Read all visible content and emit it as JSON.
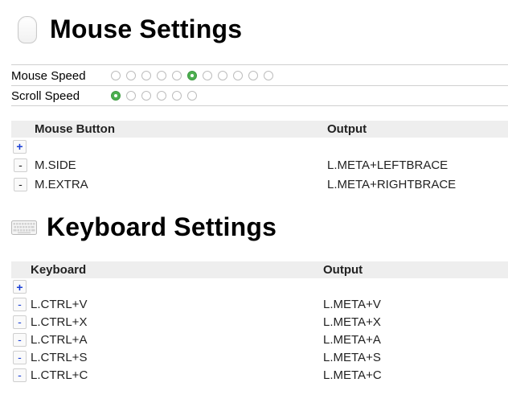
{
  "mouse_section": {
    "title": "Mouse Settings",
    "icon": "mouse-icon",
    "speed": {
      "label": "Mouse Speed",
      "count": 11,
      "selected_index": 5
    },
    "scroll": {
      "label": "Scroll Speed",
      "count": 6,
      "selected_index": 0
    },
    "accent_color": "#4caf50"
  },
  "mouse_table": {
    "headers": [
      "Mouse Button",
      "Output"
    ],
    "add_label": "+",
    "remove_label": "-",
    "rows": [
      {
        "input": "M.SIDE",
        "output": "L.META+LEFTBRACE"
      },
      {
        "input": "M.EXTRA",
        "output": "L.META+RIGHTBRACE"
      }
    ]
  },
  "keyboard_section": {
    "title": "Keyboard Settings",
    "icon": "keyboard-icon"
  },
  "keyboard_table": {
    "headers": [
      "Keyboard",
      "Output"
    ],
    "add_label": "+",
    "remove_label": "-",
    "rows": [
      {
        "input": "L.CTRL+V",
        "output": "L.META+V"
      },
      {
        "input": "L.CTRL+X",
        "output": "L.META+X"
      },
      {
        "input": "L.CTRL+A",
        "output": "L.META+A"
      },
      {
        "input": "L.CTRL+S",
        "output": "L.META+S"
      },
      {
        "input": "L.CTRL+C",
        "output": "L.META+C"
      }
    ]
  }
}
